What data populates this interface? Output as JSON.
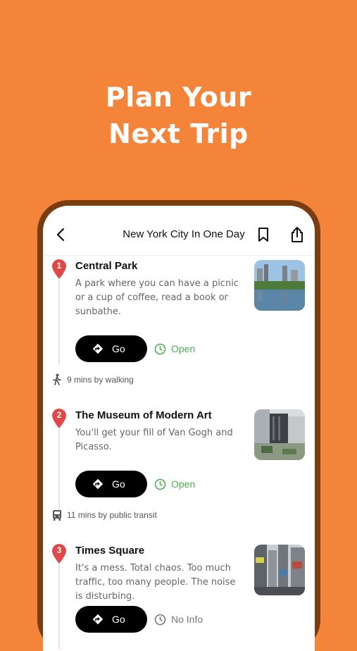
{
  "headline": {
    "line1": "Plan Your",
    "line2": "Next Trip"
  },
  "nav": {
    "title": "New York City In One Day"
  },
  "stops": [
    {
      "number": "1",
      "title": "Central Park",
      "description": "A park where you can have a picnic or a cup of coffee, read a book or sunbathe.",
      "go_label": "Go",
      "status": "Open"
    },
    {
      "number": "2",
      "title": "The Museum of Modern Art",
      "description": "You'll get your fill of Van Gogh and Picasso.",
      "go_label": "Go",
      "status": "Open"
    },
    {
      "number": "3",
      "title": "Times Square",
      "description": "It's a mess. Total chaos. Too much traffic, too many people. The noise is disturbing.",
      "go_label": "Go",
      "status": "No Info"
    }
  ],
  "transit": [
    {
      "label": "9 mins by walking",
      "icon": "walking-icon"
    },
    {
      "label": "11 mins by public transit",
      "icon": "bus-icon"
    }
  ],
  "colors": {
    "background": "#F3843A",
    "phone_frame": "#7A3D12",
    "pin": "#E04848",
    "open_status": "#4CAF50",
    "button": "#000000"
  }
}
